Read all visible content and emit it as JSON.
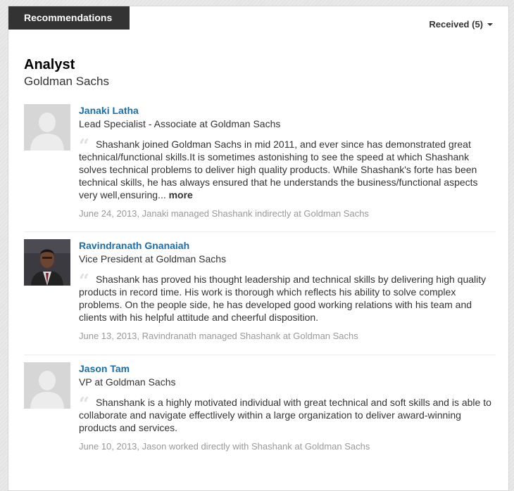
{
  "tab": {
    "label": "Recommendations"
  },
  "filter": {
    "label": "Received (5)"
  },
  "position": {
    "title": "Analyst",
    "company": "Goldman Sachs"
  },
  "recommendations": [
    {
      "name": "Janaki Latha",
      "headline": "Lead Specialist - Associate at Goldman Sachs",
      "quote_mark": "“",
      "text": "Shashank joined Goldman Sachs in mid 2011, and ever since has demonstrated great technical/functional skills.It is sometimes astonishing to see the speed at which Shashank solves technical problems to deliver high quality products. While Shashank's forte has been technical skills, he has always ensured that he understands the business/functional aspects very well,ensuring...",
      "more_label": "more",
      "meta": "June 24, 2013, Janaki managed Shashank indirectly at Goldman Sachs",
      "avatar": "placeholder-avatar"
    },
    {
      "name": "Ravindranath Gnanaiah",
      "headline": "Vice President at Goldman Sachs",
      "quote_mark": "“",
      "text": "Shashank has proved his thought leadership and technical skills by delivering high quality products in record time. His work is thorough which reflects his ability to solve complex problems. On the people side, he has developed good working relations with his team and clients with his helpful attitude and cheerful disposition.",
      "meta": "June 13, 2013, Ravindranath managed Shashank at Goldman Sachs",
      "avatar": "photo"
    },
    {
      "name": "Jason Tam",
      "headline": "VP at Goldman Sachs",
      "quote_mark": "“",
      "text": "Shanshank is a highly motivated individual with great technical and soft skills and is able to collaborate and navigate effectlively within a large organization to deliver award-winning products and services.",
      "meta": "June 10, 2013, Jason worked directly with Shashank at Goldman Sachs",
      "avatar": "placeholder-avatar"
    }
  ]
}
